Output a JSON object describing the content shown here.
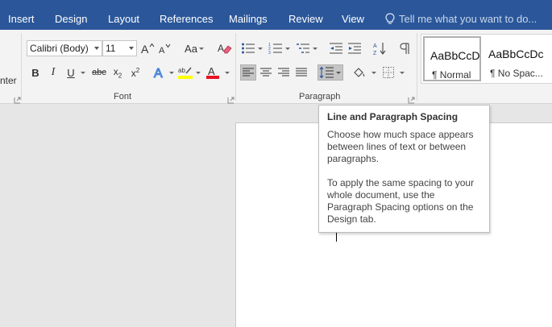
{
  "tabs": [
    "Insert",
    "Design",
    "Layout",
    "References",
    "Mailings",
    "Review",
    "View"
  ],
  "tell_me": "Tell me what you want to do...",
  "ribbon": {
    "partial_label": "nter",
    "font": {
      "name": "Calibri (Body)",
      "size": "11",
      "change_case_label": "Aa",
      "bold": "B",
      "italic": "I",
      "underline": "U",
      "strike": "abc",
      "subscript": "x",
      "subscript_sub": "2",
      "superscript": "x",
      "superscript_sup": "2",
      "group_label": "Font"
    },
    "paragraph": {
      "group_label": "Paragraph"
    },
    "styles": [
      {
        "sample": "AaBbCcDc",
        "name": "¶ Normal"
      },
      {
        "sample": "AaBbCcDc",
        "name": "¶ No Spac..."
      }
    ]
  },
  "tooltip": {
    "title": "Line and Paragraph Spacing",
    "para1": "Choose how much space appears between lines of text or between paragraphs.",
    "para2": "To apply the same spacing to your whole document, use the Paragraph Spacing options on the Design tab."
  },
  "colors": {
    "tab_bar": "#2b579a",
    "highlight": "#ffff00",
    "font_color": "#e81123"
  }
}
